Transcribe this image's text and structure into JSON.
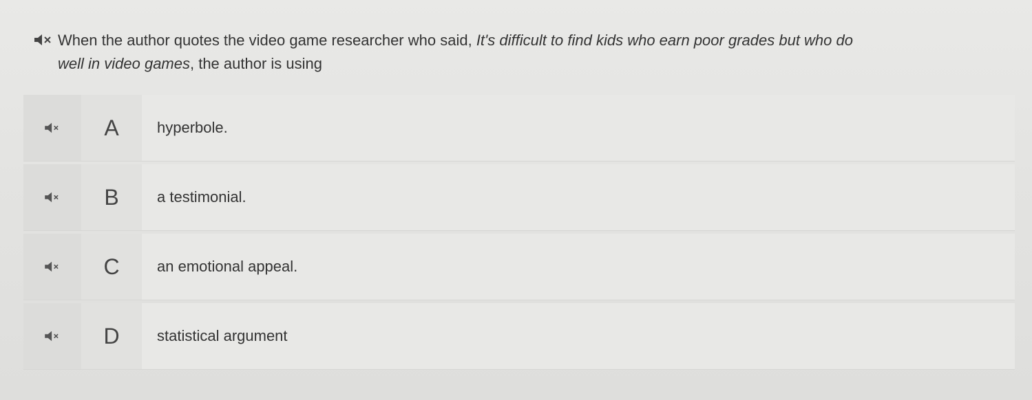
{
  "question": {
    "prefix": "When the author quotes the video game researcher who said, ",
    "quote_line1": "It's difficult to find kids who earn poor grades but who do",
    "quote_line2": "well in video games",
    "suffix": ", the author is using",
    "audio_icon": "speaker-muted-icon"
  },
  "choices": [
    {
      "letter": "A",
      "text": "hyperbole.",
      "audio_icon": "speaker-muted-icon"
    },
    {
      "letter": "B",
      "text": "a testimonial.",
      "audio_icon": "speaker-muted-icon"
    },
    {
      "letter": "C",
      "text": "an emotional appeal.",
      "audio_icon": "speaker-muted-icon"
    },
    {
      "letter": "D",
      "text": "statistical argument",
      "audio_icon": "speaker-muted-icon"
    }
  ]
}
